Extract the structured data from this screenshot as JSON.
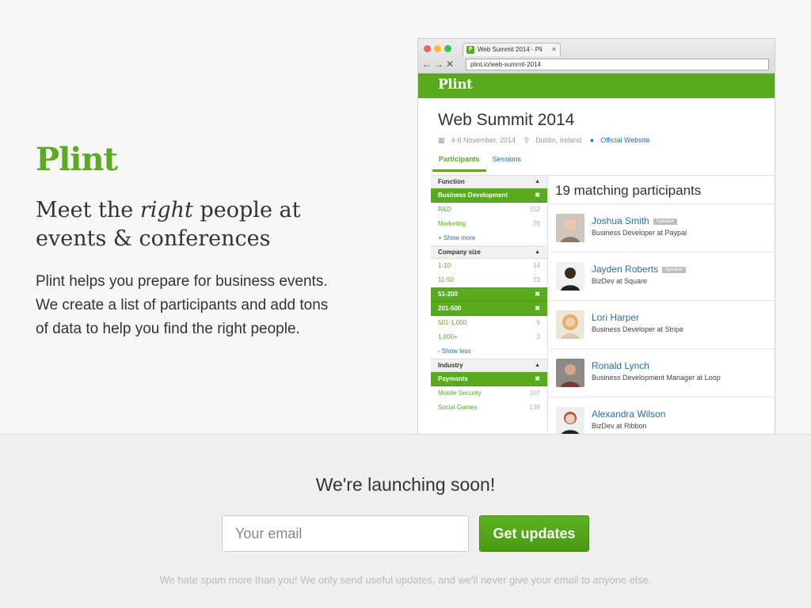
{
  "hero": {
    "logo": "Plint",
    "headline_pre": "Meet the ",
    "headline_em": "right",
    "headline_post": " people at events & conferences",
    "description": "Plint helps you prepare for business events. We create a list of participants and add tons of data to help you find the right people."
  },
  "browser": {
    "tab_title": "Web Summit 2014 - Pli",
    "url": "plint.io/web-summit-2014",
    "app_logo": "Plint",
    "event": {
      "title": "Web Summit 2014",
      "date": "4-6 November, 2014",
      "location": "Dublin, Ireland",
      "website": "Official Website"
    },
    "tabs": [
      "Participants",
      "Sessions"
    ],
    "filters": {
      "function": {
        "title": "Function",
        "items": [
          {
            "label": "Business Development",
            "count": "",
            "selected": true
          },
          {
            "label": "R&D",
            "count": "152",
            "selected": false
          },
          {
            "label": "Marketing",
            "count": "76",
            "selected": false
          }
        ],
        "toggle": "+ Show more"
      },
      "company_size": {
        "title": "Company size",
        "items": [
          {
            "label": "1-10",
            "count": "14",
            "selected": false
          },
          {
            "label": "11-50",
            "count": "23",
            "selected": false
          },
          {
            "label": "51-200",
            "count": "",
            "selected": true
          },
          {
            "label": "201-500",
            "count": "",
            "selected": true
          },
          {
            "label": "501-1,000",
            "count": "9",
            "selected": false
          },
          {
            "label": "1,000+",
            "count": "3",
            "selected": false
          }
        ],
        "toggle": "- Show less"
      },
      "industry": {
        "title": "Industry",
        "items": [
          {
            "label": "Payments",
            "count": "",
            "selected": true
          },
          {
            "label": "Mobile Security",
            "count": "107",
            "selected": false
          },
          {
            "label": "Social Games",
            "count": "139",
            "selected": false
          }
        ]
      }
    },
    "results_title": "19 matching participants",
    "participants": [
      {
        "name": "Joshua Smith",
        "badge": "Speaker",
        "role": "Business Developer at Paypal"
      },
      {
        "name": "Jayden Roberts",
        "badge": "Speaker",
        "role": "BizDev at Square"
      },
      {
        "name": "Lori Harper",
        "badge": "",
        "role": "Business Developer at Stripe"
      },
      {
        "name": "Ronald Lynch",
        "badge": "",
        "role": "Business Development Manager at Loop"
      },
      {
        "name": "Alexandra Wilson",
        "badge": "",
        "role": "BizDev at Ribbon"
      }
    ]
  },
  "launch": {
    "title": "We're launching soon!",
    "email_placeholder": "Your email",
    "button": "Get updates",
    "note": "We hate spam more than you! We only send useful updates, and we'll never give your email to anyone else."
  },
  "colors": {
    "brand_green": "#5aab1e",
    "link_blue": "#2a6ea8"
  }
}
